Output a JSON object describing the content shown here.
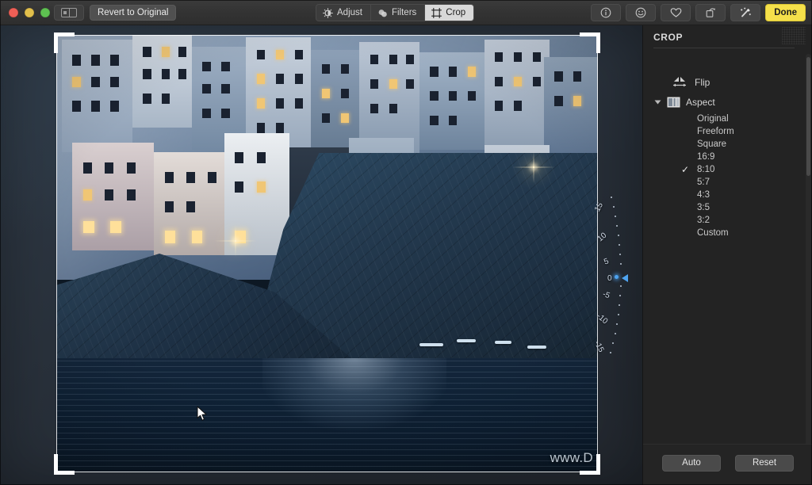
{
  "window": {
    "traffic_lights": [
      "close",
      "minimize",
      "maximize"
    ],
    "sidebar_toggle_icon": "sidebar-toggle-icon",
    "revert_label": "Revert to Original"
  },
  "toolbar": {
    "modes": [
      {
        "label": "Adjust",
        "icon": "adjust-icon",
        "active": false
      },
      {
        "label": "Filters",
        "icon": "filters-icon",
        "active": false
      },
      {
        "label": "Crop",
        "icon": "crop-icon",
        "active": true
      }
    ],
    "buttons": [
      {
        "name": "info-icon",
        "glyph": "ⓘ"
      },
      {
        "name": "face-icon",
        "glyph": "☺"
      },
      {
        "name": "favorite-heart-icon",
        "glyph": "♡"
      },
      {
        "name": "rotate-icon",
        "glyph": "↻"
      },
      {
        "name": "magic-wand-icon",
        "glyph": "✨"
      }
    ],
    "done_label": "Done",
    "done_color": "#f5e04a"
  },
  "canvas": {
    "photo_watermark": "www.D",
    "cursor": "arrow-cursor",
    "crop_aspect_applied": "8:10"
  },
  "dial": {
    "name": "straighten-rotation-dial",
    "unit": "degrees",
    "current_value": "0",
    "ticks": [
      "15",
      "10",
      "5",
      "0",
      "-5",
      "-10",
      "-15"
    ],
    "pointer_color": "#4ea3f0"
  },
  "panel": {
    "title": "CROP",
    "flip": {
      "label": "Flip",
      "icon": "flip-horizontal-icon"
    },
    "aspect": {
      "label": "Aspect",
      "icon": "aspect-icon",
      "expanded": true
    },
    "aspect_options": [
      {
        "label": "Original",
        "checked": false
      },
      {
        "label": "Freeform",
        "checked": false
      },
      {
        "label": "Square",
        "checked": false
      },
      {
        "label": "16:9",
        "checked": false
      },
      {
        "label": "8:10",
        "checked": true
      },
      {
        "label": "5:7",
        "checked": false
      },
      {
        "label": "4:3",
        "checked": false
      },
      {
        "label": "3:5",
        "checked": false
      },
      {
        "label": "3:2",
        "checked": false
      },
      {
        "label": "Custom",
        "checked": false
      }
    ],
    "check_glyph": "✓",
    "footer": {
      "auto_label": "Auto",
      "reset_label": "Reset"
    }
  }
}
